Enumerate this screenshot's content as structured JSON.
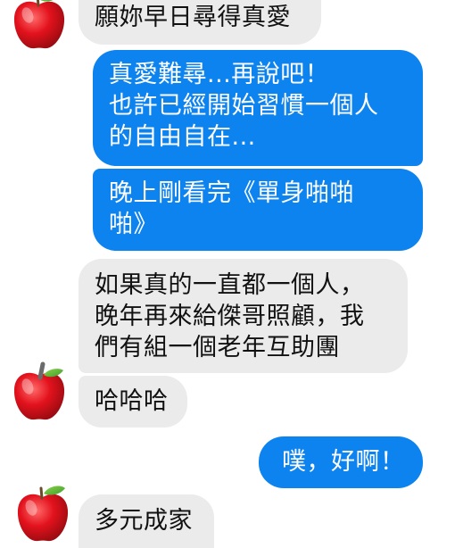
{
  "messages": [
    {
      "side": "incoming",
      "text": "願妳早日尋得真愛"
    },
    {
      "side": "outgoing",
      "text": "真愛難尋...再說吧！\n也許已經開始習慣一個人\n的自由自在..."
    },
    {
      "side": "outgoing",
      "text": "晚上剛看完《單身啪啪\n啪》"
    },
    {
      "side": "incoming",
      "text": "如果真的一直都一個人，\n晚年再來給傑哥照顧，我\n們有組一個老年互助團"
    },
    {
      "side": "incoming",
      "text": "哈哈哈"
    },
    {
      "side": "outgoing",
      "text": "噗，好啊！"
    },
    {
      "side": "incoming",
      "text": "多元成家"
    }
  ],
  "avatar": {
    "icon": "red-apple-icon",
    "color": "#e3121d",
    "leaf_color": "#4caf36"
  },
  "colors": {
    "outgoing_bubble": "#0d83f0",
    "incoming_bubble": "#ebebeb",
    "background": "#ffffff"
  }
}
